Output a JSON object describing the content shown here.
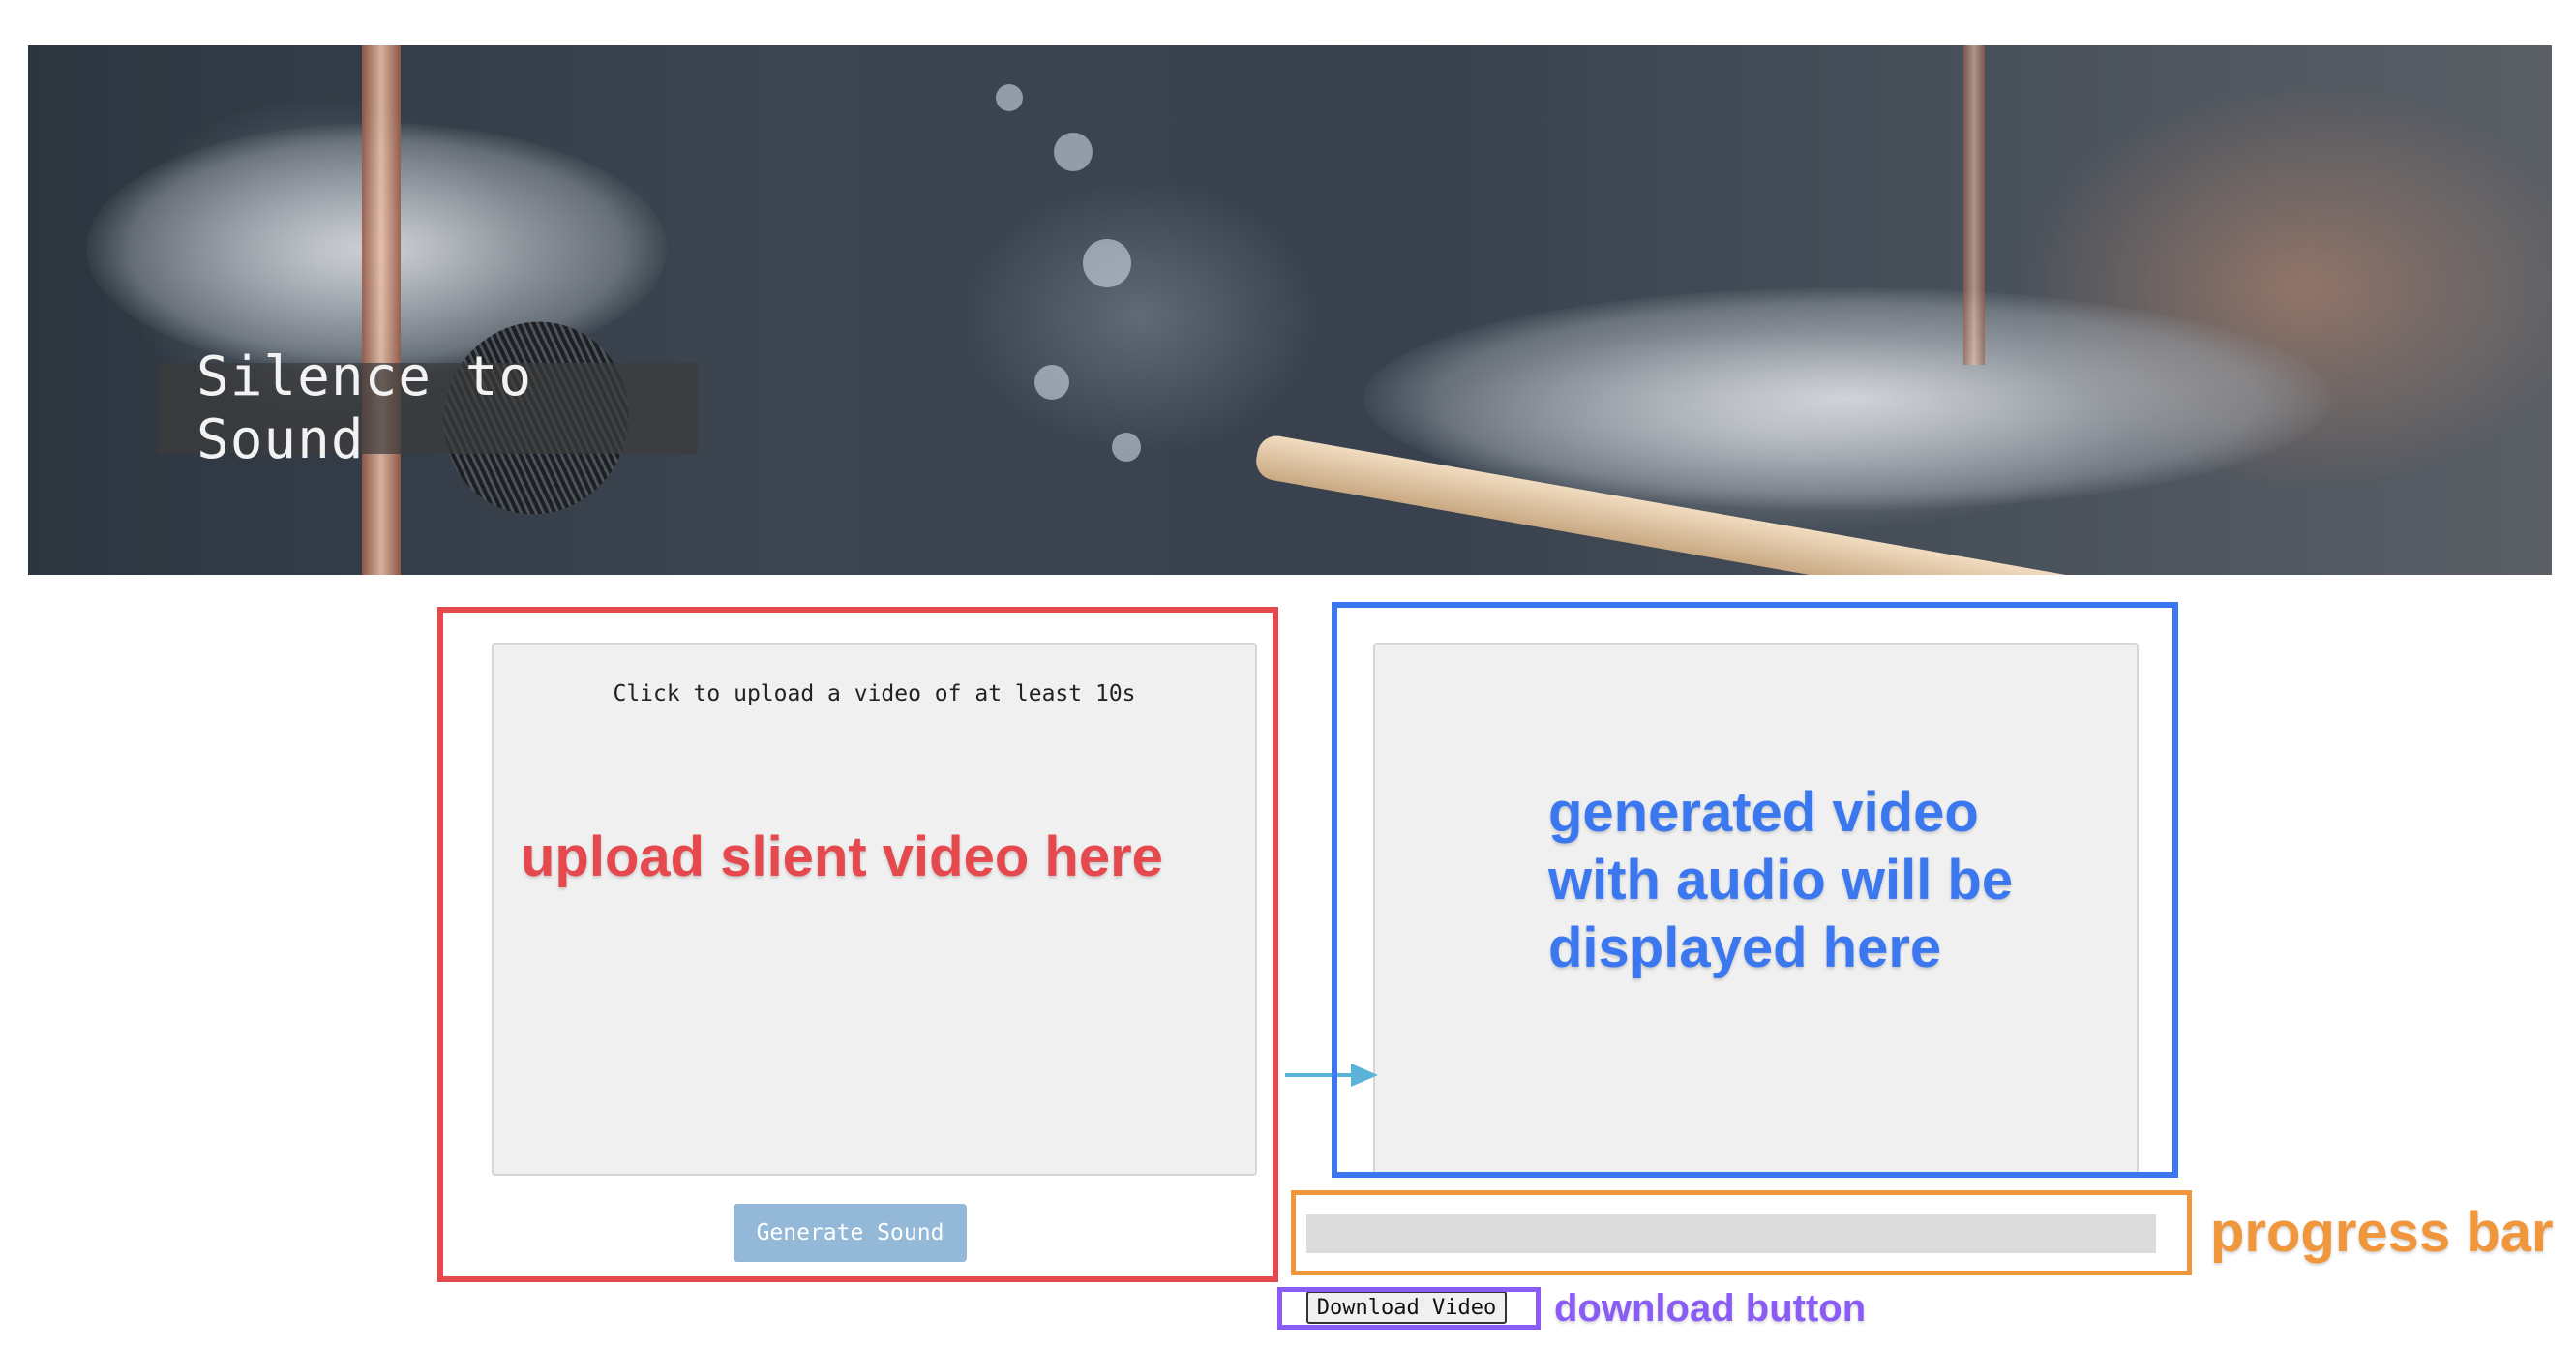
{
  "hero": {
    "title": "Silence to Sound"
  },
  "upload": {
    "prompt": "Click to upload a video of at least 10s",
    "generate_label": "Generate Sound"
  },
  "output": {
    "download_label": "Download Video"
  },
  "progress": {
    "fraction": 0
  },
  "annotations": {
    "upload_note": "upload slient video here",
    "output_note": "generated video with audio will be displayed here",
    "progress_note": "progress bar",
    "download_note": "download button"
  },
  "colors": {
    "annotation_red": "#e5484d",
    "annotation_blue": "#3b78f0",
    "annotation_orange": "#f0963c",
    "annotation_purple": "#8a5cf6",
    "arrow": "#5bb3d8",
    "generate_button": "#93b8d8",
    "panel_background": "#f0f0f0",
    "progress_track": "#dcdcdc"
  }
}
